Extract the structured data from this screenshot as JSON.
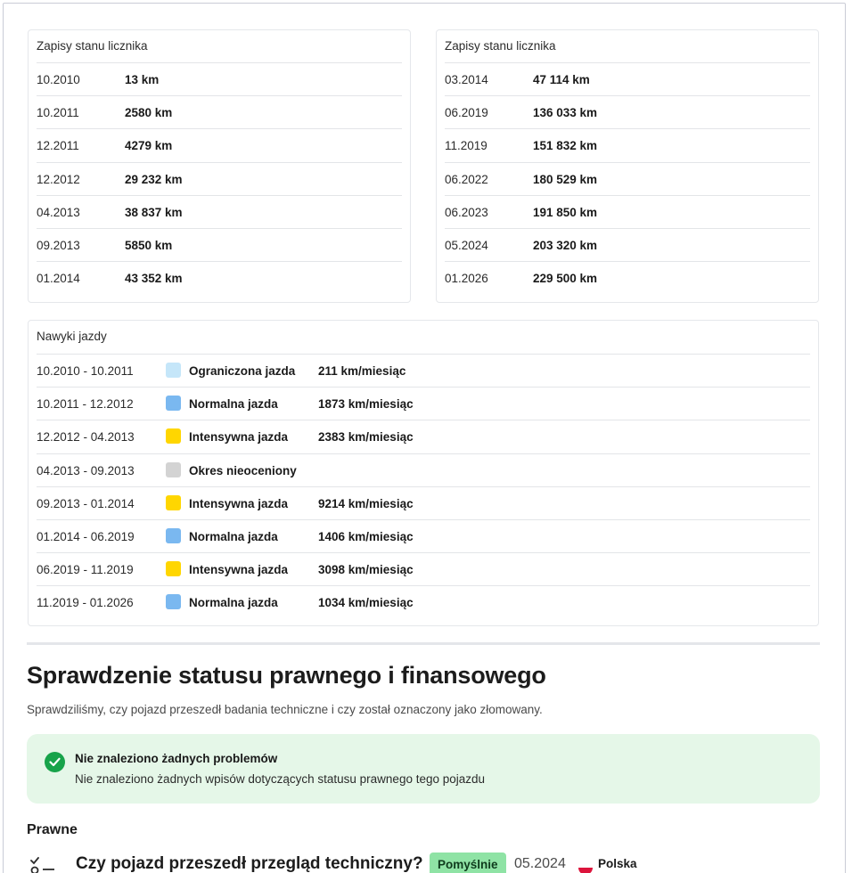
{
  "odometer_left": {
    "title": "Zapisy stanu licznika",
    "rows": [
      {
        "date": "10.2010",
        "km": "13 km"
      },
      {
        "date": "10.2011",
        "km": "2580 km"
      },
      {
        "date": "12.2011",
        "km": "4279 km"
      },
      {
        "date": "12.2012",
        "km": "29 232 km"
      },
      {
        "date": "04.2013",
        "km": "38 837 km"
      },
      {
        "date": "09.2013",
        "km": "5850 km"
      },
      {
        "date": "01.2014",
        "km": "43 352 km"
      }
    ]
  },
  "odometer_right": {
    "title": "Zapisy stanu licznika",
    "rows": [
      {
        "date": "03.2014",
        "km": "47 114 km"
      },
      {
        "date": "06.2019",
        "km": "136 033 km"
      },
      {
        "date": "11.2019",
        "km": "151 832 km"
      },
      {
        "date": "06.2022",
        "km": "180 529 km"
      },
      {
        "date": "06.2023",
        "km": "191 850 km"
      },
      {
        "date": "05.2024",
        "km": "203 320 km"
      },
      {
        "date": "01.2026",
        "km": "229 500 km"
      }
    ]
  },
  "habits": {
    "title": "Nawyki jazdy",
    "rows": [
      {
        "period": "10.2010 - 10.2011",
        "label": "Ograniczona jazda",
        "rate": "211 km/miesiąc",
        "color": "#c5e6f9"
      },
      {
        "period": "10.2011 - 12.2012",
        "label": "Normalna jazda",
        "rate": "1873 km/miesiąc",
        "color": "#7ab8f0"
      },
      {
        "period": "12.2012 - 04.2013",
        "label": "Intensywna jazda",
        "rate": "2383 km/miesiąc",
        "color": "#ffd600"
      },
      {
        "period": "04.2013 - 09.2013",
        "label": "Okres nieoceniony",
        "rate": "",
        "color": "#d3d3d3"
      },
      {
        "period": "09.2013 - 01.2014",
        "label": "Intensywna jazda",
        "rate": "9214 km/miesiąc",
        "color": "#ffd600"
      },
      {
        "period": "01.2014 - 06.2019",
        "label": "Normalna jazda",
        "rate": "1406 km/miesiąc",
        "color": "#7ab8f0"
      },
      {
        "period": "06.2019 - 11.2019",
        "label": "Intensywna jazda",
        "rate": "3098 km/miesiąc",
        "color": "#ffd600"
      },
      {
        "period": "11.2019 - 01.2026",
        "label": "Normalna jazda",
        "rate": "1034 km/miesiąc",
        "color": "#7ab8f0"
      }
    ]
  },
  "legal": {
    "title": "Sprawdzenie statusu prawnego i finansowego",
    "subtitle": "Sprawdziliśmy, czy pojazd przeszedł badania techniczne i czy został oznaczony jako złomowany.",
    "ok_title": "Nie znaleziono żadnych problemów",
    "ok_text": "Nie znaleziono żadnych wpisów dotyczących statusu prawnego tego pojazdu",
    "ok_icon": "check-circle-icon",
    "sub_heading": "Prawne",
    "question": "Czy pojazd przeszedł przegląd techniczny?",
    "badge": "Pomyślnie",
    "date": "05.2024",
    "country": "Polska",
    "flag_icon": "poland-flag-icon"
  }
}
